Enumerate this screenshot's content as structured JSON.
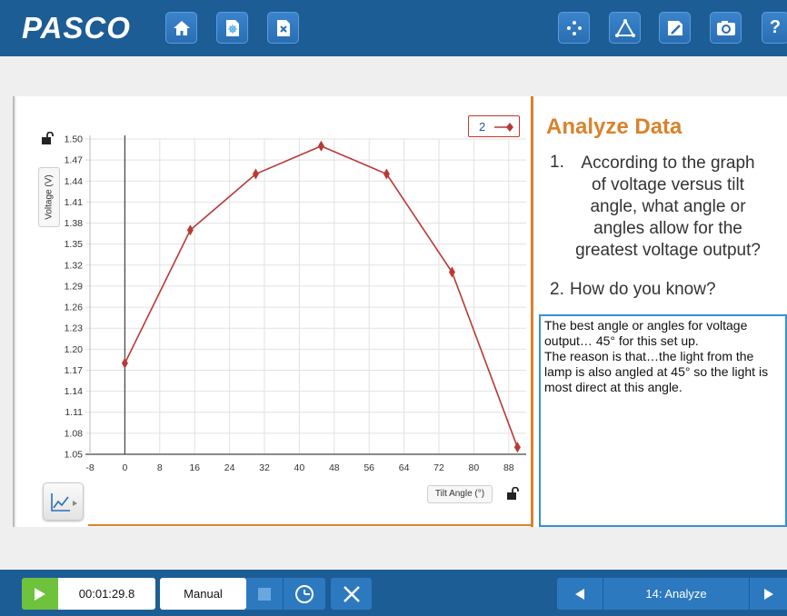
{
  "app": {
    "logo_text": "PASCO"
  },
  "toolbar": {
    "left_icons": [
      "home-icon",
      "new-experiment-icon",
      "close-experiment-icon"
    ],
    "right_icons": [
      "data-summary-icon",
      "tools-icon",
      "journal-icon",
      "snapshot-icon",
      "help-icon"
    ]
  },
  "chart_data": {
    "type": "line",
    "x": [
      0,
      15,
      30,
      45,
      60,
      75,
      90
    ],
    "y": [
      1.18,
      1.37,
      1.45,
      1.49,
      1.45,
      1.31,
      1.06
    ],
    "xlabel": "Tilt Angle (°)",
    "ylabel": "Voltage (V)",
    "xlim": [
      -8,
      92
    ],
    "ylim": [
      1.05,
      1.5
    ],
    "x_ticks": [
      "-8",
      "0",
      "8",
      "16",
      "24",
      "32",
      "40",
      "48",
      "56",
      "64",
      "72",
      "80",
      "88"
    ],
    "y_ticks": [
      "1.05",
      "1.08",
      "1.11",
      "1.14",
      "1.17",
      "1.20",
      "1.23",
      "1.26",
      "1.29",
      "1.32",
      "1.35",
      "1.38",
      "1.41",
      "1.44",
      "1.47",
      "1.50"
    ],
    "grid": true,
    "legend": {
      "label": "2",
      "position": "top-right"
    },
    "series_color": "#b83a35"
  },
  "analyze": {
    "title": "Analyze Data",
    "q1_num": "1.",
    "q1_lines": [
      "According to the graph",
      "of voltage versus tilt",
      "angle, what angle or",
      "angles allow for the",
      "greatest voltage output?"
    ],
    "q2_num": "2.",
    "q2_text": "How do you know?",
    "answer": "The best angle or angles for voltage output… 45° for this set up.\nThe reason is that…the light from the lamp is also angled at 45° so the light is most direct at this angle."
  },
  "bottom": {
    "time": "00:01:29.8",
    "mode": "Manual",
    "page": "14: Analyze"
  },
  "colors": {
    "brand_blue": "#1d5d96",
    "accent_orange": "#d9822b",
    "play_green": "#6fc23c"
  }
}
